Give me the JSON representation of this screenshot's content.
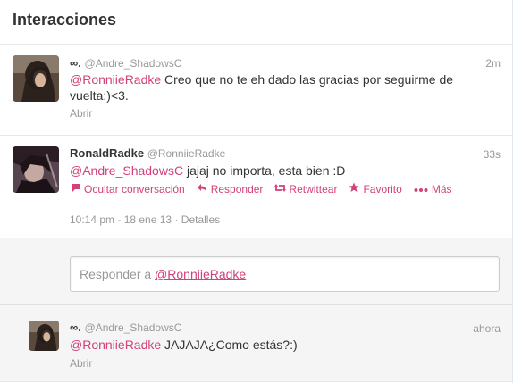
{
  "header": {
    "title": "Interacciones"
  },
  "tweets": [
    {
      "name": "∞.",
      "handle": "@Andre_ShadowsC",
      "time": "2m",
      "mention": "@RonniieRadke",
      "text": " Creo que no te eh dado las gracias por seguirme de vuelta:)<3.",
      "abrir": "Abrir"
    },
    {
      "name": "RonaldRadke",
      "handle": "@RonniieRadke",
      "time": "33s",
      "mention": "@Andre_ShadowsC",
      "text": " jajaj no importa, esta bien :D",
      "actions": {
        "hide": "Ocultar conversación",
        "reply": "Responder",
        "retweet": "Retwittear",
        "favorite": "Favorito",
        "more": "Más"
      },
      "datetime": "10:14 pm - 18 ene 13",
      "separator": "·",
      "details": "Detalles",
      "reply_prefix": "Responder a ",
      "reply_mention": "@RonniieRadke"
    },
    {
      "name": "∞.",
      "handle": "@Andre_ShadowsC",
      "time": "ahora",
      "mention": "@RonniieRadke",
      "text": " JAJAJA¿Como estás?:)",
      "abrir": "Abrir"
    }
  ],
  "colors": {
    "accent": "#d1417a",
    "muted": "#999999",
    "text": "#333333",
    "border": "#e8e8e8",
    "expanded_bg": "#f5f5f5"
  },
  "icons": {
    "hide": "speech-bubble-icon",
    "reply": "reply-arrow-icon",
    "retweet": "retweet-icon",
    "favorite": "star-icon",
    "more": "dots-icon"
  }
}
